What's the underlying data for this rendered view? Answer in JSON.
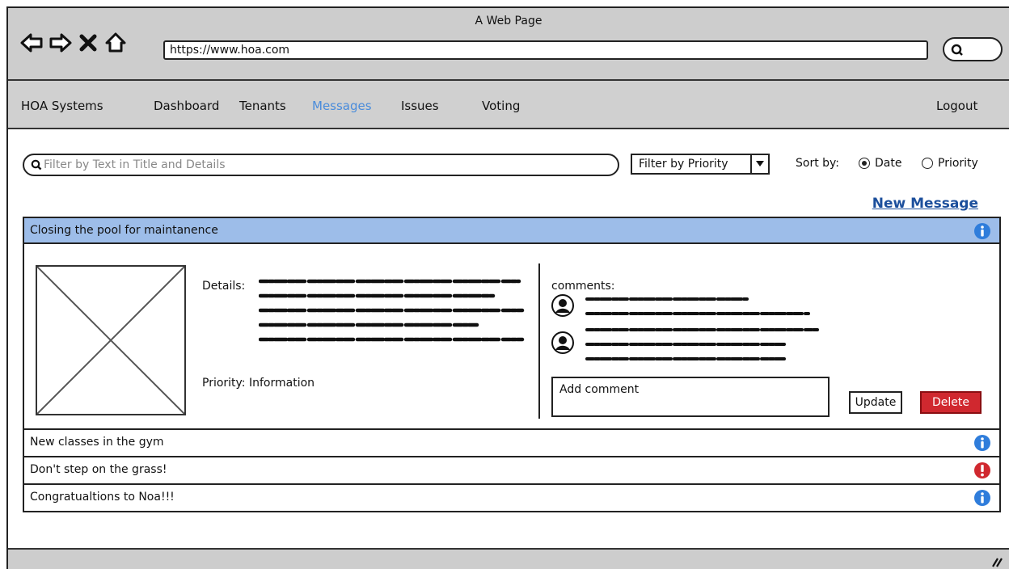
{
  "window": {
    "title": "A Web Page"
  },
  "browser": {
    "url": "https://www.hoa.com",
    "nav_icons": [
      "back-arrow-icon",
      "forward-arrow-icon",
      "close-x-icon",
      "home-icon"
    ],
    "search_icon": "search-icon"
  },
  "nav": {
    "brand": "HOA Systems",
    "items": [
      {
        "label": "Dashboard",
        "active": false
      },
      {
        "label": "Tenants",
        "active": false
      },
      {
        "label": "Messages",
        "active": true
      },
      {
        "label": "Issues",
        "active": false
      },
      {
        "label": "Voting",
        "active": false
      }
    ],
    "logout": "Logout",
    "active_color": "#4a8cdb"
  },
  "filters": {
    "search_placeholder": "Filter by Text in Title and Details",
    "priority_select": "Filter by Priority",
    "sort_label": "Sort by:",
    "sort_options": [
      {
        "label": "Date",
        "selected": true
      },
      {
        "label": "Priority",
        "selected": false
      }
    ]
  },
  "new_message": "New Message",
  "messages": [
    {
      "title": "Closing the pool for maintanence",
      "icon": "info-icon",
      "expanded": true
    },
    {
      "title": "New classes in the gym",
      "icon": "info-icon",
      "expanded": false
    },
    {
      "title": "Don't step on the grass!",
      "icon": "alert-icon",
      "expanded": false
    },
    {
      "title": "Congratualtions to Noa!!!",
      "icon": "info-icon",
      "expanded": false
    }
  ],
  "detail": {
    "details_label": "Details:",
    "priority_label": "Priority: Information",
    "comments_label": "comments:",
    "add_comment_placeholder": "Add comment",
    "update_label": "Update",
    "delete_label": "Delete"
  },
  "colors": {
    "selected_row": "#9dbde9",
    "info": "#2f7ddb",
    "alert": "#d0282f",
    "delete": "#d0282f",
    "link": "#1c4f9c"
  }
}
